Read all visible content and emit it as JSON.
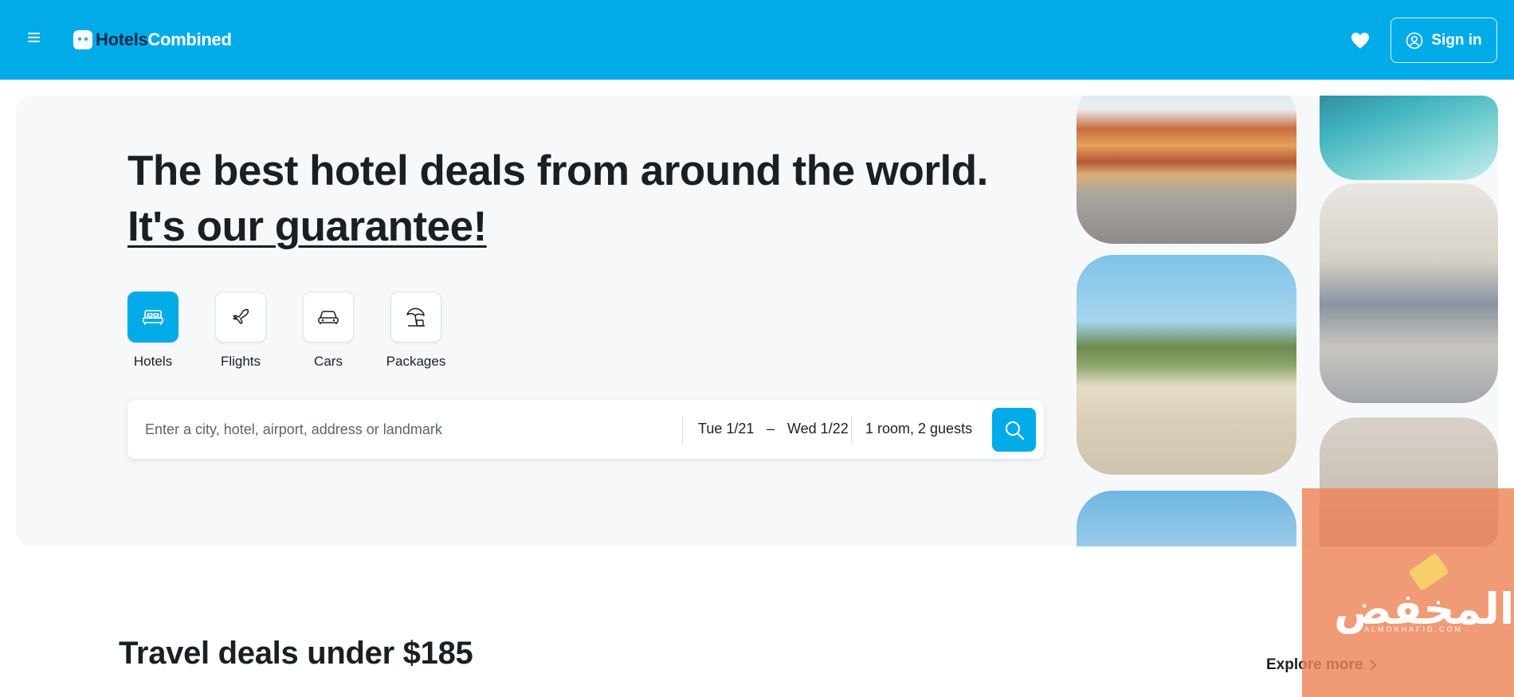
{
  "header": {
    "brand_part1": "Hotels",
    "brand_part2": "Combined",
    "signin_label": "Sign in",
    "accent": "#00abe8"
  },
  "hero": {
    "headline": "The best hotel deals from around the world.",
    "headline_link": "It's our guarantee!"
  },
  "verticals": [
    {
      "label": "Hotels",
      "icon": "bed-icon",
      "active": true
    },
    {
      "label": "Flights",
      "icon": "plane-icon",
      "active": false
    },
    {
      "label": "Cars",
      "icon": "car-icon",
      "active": false
    },
    {
      "label": "Packages",
      "icon": "umbrella-icon",
      "active": false
    }
  ],
  "search": {
    "placeholder": "Enter a city, hotel, airport, address or landmark",
    "checkin": "Tue 1/21",
    "separator": "–",
    "checkout": "Wed 1/22",
    "guests": "1 room, 2 guests"
  },
  "watermark": {
    "arabic": "المخفض",
    "latin": "ALMOKHAFID.COM"
  },
  "deals": {
    "title": "Travel deals under $185",
    "explore_label": "Explore more"
  }
}
